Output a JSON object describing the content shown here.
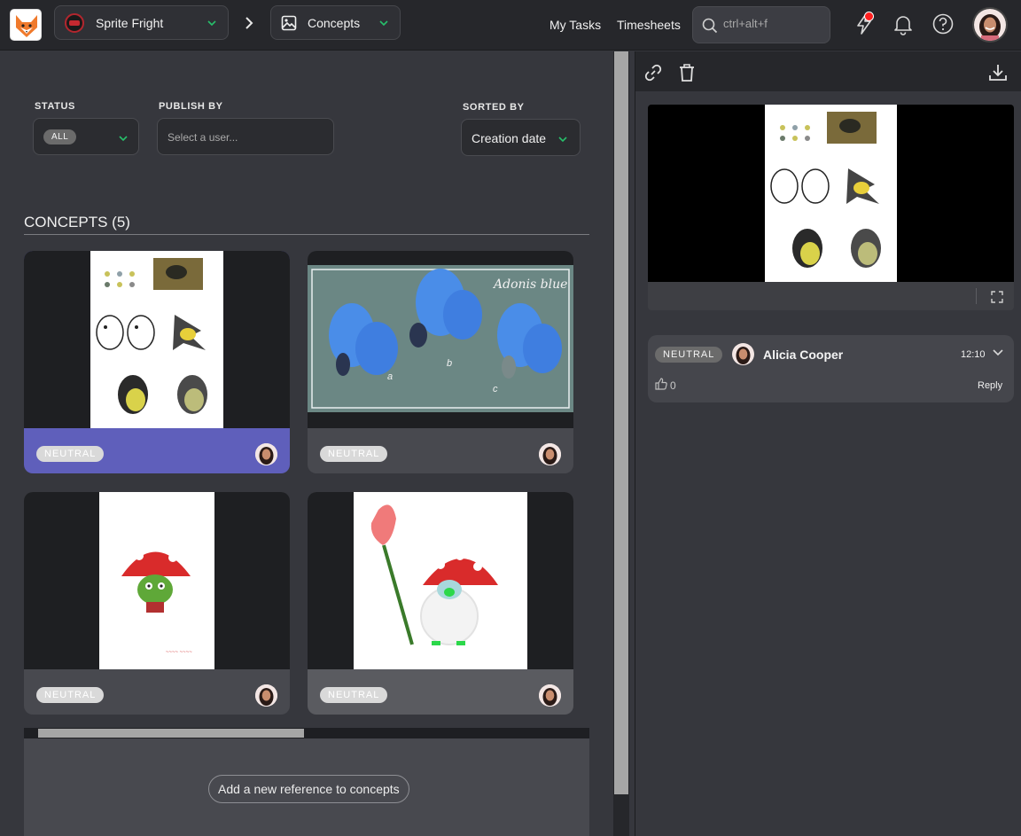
{
  "topbar": {
    "production": "Sprite Fright",
    "section": "Concepts",
    "nav": {
      "my_tasks": "My Tasks",
      "timesheets": "Timesheets"
    },
    "search_placeholder": "ctrl+alt+f"
  },
  "filters": {
    "status_label": "STATUS",
    "status_value": "ALL",
    "publish_label": "PUBLISH BY",
    "publish_placeholder": "Select a user...",
    "sorted_label": "SORTED BY",
    "sorted_value": "Creation date"
  },
  "concepts": {
    "title": "CONCEPTS (5)",
    "cards": [
      {
        "status": "NEUTRAL",
        "image": "bird-sketches-thumbnail",
        "selected": true
      },
      {
        "status": "NEUTRAL",
        "image": "adonis-blue-butterflies-thumbnail",
        "caption": "Adonis blue",
        "labels": [
          "a",
          "b",
          "c"
        ]
      },
      {
        "status": "NEUTRAL",
        "image": "mushroom-goblin-thumbnail"
      },
      {
        "status": "NEUTRAL",
        "image": "mushroom-with-rose-thumbnail"
      }
    ],
    "add_button": "Add a new reference to concepts"
  },
  "comment": {
    "status": "NEUTRAL",
    "author": "Alicia Cooper",
    "time": "12:10",
    "likes": "0",
    "reply": "Reply"
  },
  "colors": {
    "selected_card": "#5f5fbb",
    "accent_green": "#27c06b",
    "notification": "#ff1f1f"
  }
}
